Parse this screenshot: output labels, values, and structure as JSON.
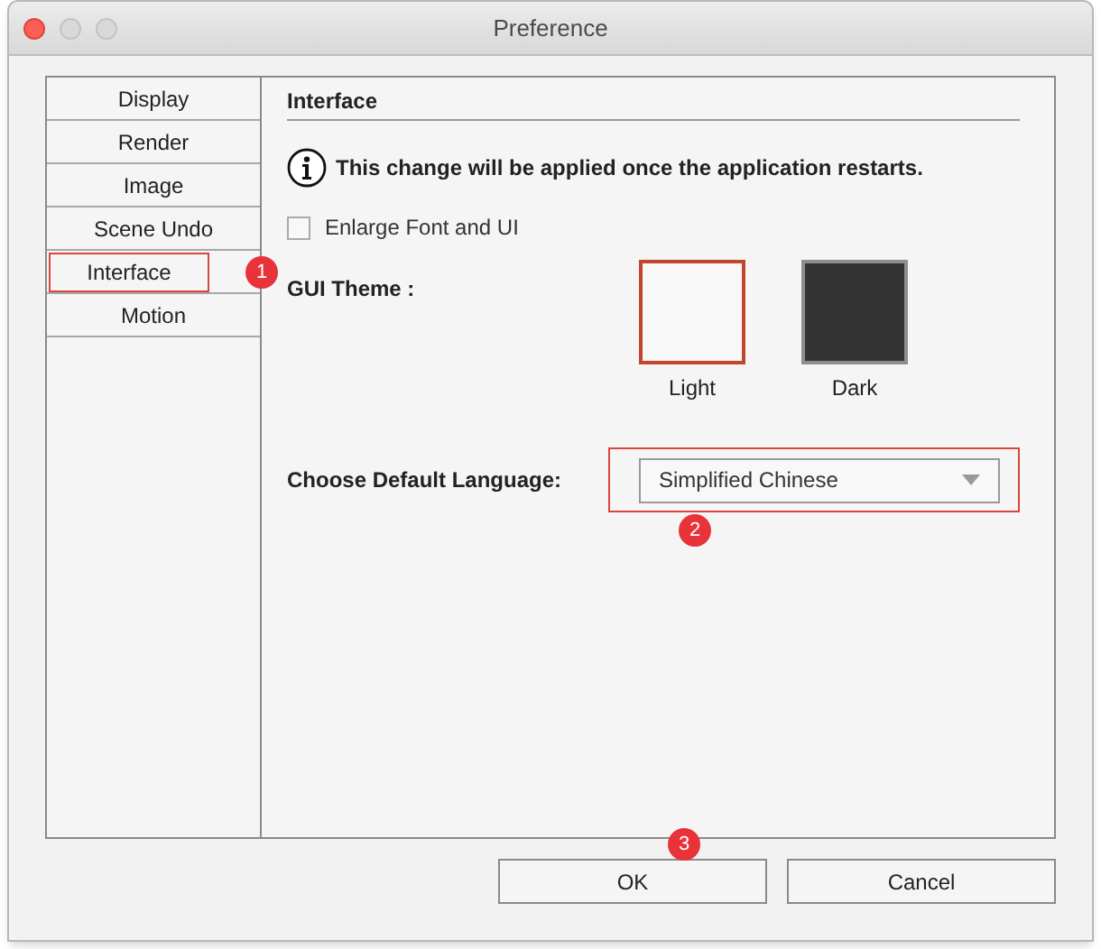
{
  "window": {
    "title": "Preference"
  },
  "sidebar": {
    "items": [
      {
        "label": "Display",
        "selected": false
      },
      {
        "label": "Render",
        "selected": false
      },
      {
        "label": "Image",
        "selected": false
      },
      {
        "label": "Scene Undo",
        "selected": false
      },
      {
        "label": "Interface",
        "selected": true,
        "badge": "1"
      },
      {
        "label": "Motion",
        "selected": false
      }
    ]
  },
  "section_title": "Interface",
  "notice": "This change will be applied once the application restarts.",
  "enlarge": {
    "label": "Enlarge Font and UI",
    "checked": false
  },
  "theme": {
    "label": "GUI Theme :",
    "options": [
      {
        "label": "Light",
        "kind": "light",
        "selected": true
      },
      {
        "label": "Dark",
        "kind": "dark",
        "selected": false
      }
    ]
  },
  "language": {
    "label": "Choose Default Language:",
    "value": "Simplified Chinese",
    "highlighted": true,
    "badge": "2"
  },
  "buttons": [
    {
      "label": "OK",
      "badge": "3"
    },
    {
      "label": "Cancel"
    }
  ]
}
